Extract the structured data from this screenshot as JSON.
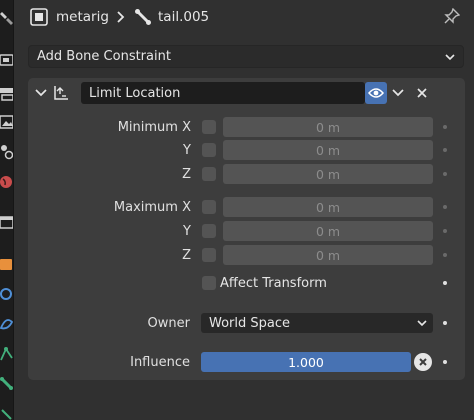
{
  "header": {
    "object_name": "metarig",
    "bone_name": "tail.005"
  },
  "add_constraint": {
    "label": "Add Bone Constraint"
  },
  "constraint": {
    "name": "Limit Location",
    "rows": {
      "min_x": {
        "label": "Minimum X",
        "value": "0 m"
      },
      "min_y": {
        "label": "Y",
        "value": "0 m"
      },
      "min_z": {
        "label": "Z",
        "value": "0 m"
      },
      "max_x": {
        "label": "Maximum X",
        "value": "0 m"
      },
      "max_y": {
        "label": "Y",
        "value": "0 m"
      },
      "max_z": {
        "label": "Z",
        "value": "0 m"
      }
    },
    "affect_transform": {
      "label": "Affect Transform",
      "checked": false
    },
    "owner": {
      "label": "Owner",
      "value": "World Space"
    },
    "influence": {
      "label": "Influence",
      "value": "1.000",
      "fraction": 1.0
    }
  },
  "colors": {
    "accent": "#4772b3",
    "panel": "#3d3d3d",
    "background": "#303030",
    "field": "#545454"
  },
  "icons": {
    "tabs": [
      "tool-icon",
      "render-icon",
      "output-icon",
      "view-layer-icon",
      "scene-icon",
      "world-icon",
      "collection-icon",
      "object-icon",
      "modifier-icon",
      "particles-icon",
      "physics-icon",
      "object-constraint-icon",
      "bone-icon"
    ],
    "header": [
      "armature-object-icon",
      "breadcrumb-arrow-icon",
      "bone-icon",
      "pin-icon"
    ],
    "constraint": [
      "collapse-chevron-icon",
      "limit-location-icon",
      "eye-icon",
      "chevron-down-icon",
      "close-icon",
      "clear-icon"
    ]
  }
}
